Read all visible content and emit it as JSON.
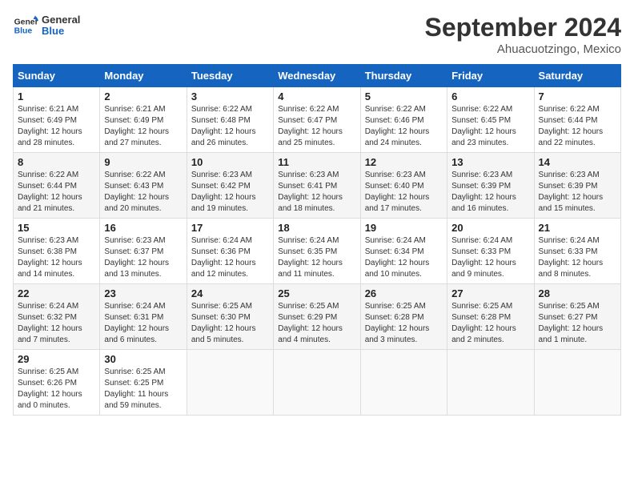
{
  "header": {
    "logo_line1": "General",
    "logo_line2": "Blue",
    "month": "September 2024",
    "location": "Ahuacuotzingo, Mexico"
  },
  "days_of_week": [
    "Sunday",
    "Monday",
    "Tuesday",
    "Wednesday",
    "Thursday",
    "Friday",
    "Saturday"
  ],
  "weeks": [
    [
      {
        "day": "1",
        "info": "Sunrise: 6:21 AM\nSunset: 6:49 PM\nDaylight: 12 hours\nand 28 minutes."
      },
      {
        "day": "2",
        "info": "Sunrise: 6:21 AM\nSunset: 6:49 PM\nDaylight: 12 hours\nand 27 minutes."
      },
      {
        "day": "3",
        "info": "Sunrise: 6:22 AM\nSunset: 6:48 PM\nDaylight: 12 hours\nand 26 minutes."
      },
      {
        "day": "4",
        "info": "Sunrise: 6:22 AM\nSunset: 6:47 PM\nDaylight: 12 hours\nand 25 minutes."
      },
      {
        "day": "5",
        "info": "Sunrise: 6:22 AM\nSunset: 6:46 PM\nDaylight: 12 hours\nand 24 minutes."
      },
      {
        "day": "6",
        "info": "Sunrise: 6:22 AM\nSunset: 6:45 PM\nDaylight: 12 hours\nand 23 minutes."
      },
      {
        "day": "7",
        "info": "Sunrise: 6:22 AM\nSunset: 6:44 PM\nDaylight: 12 hours\nand 22 minutes."
      }
    ],
    [
      {
        "day": "8",
        "info": "Sunrise: 6:22 AM\nSunset: 6:44 PM\nDaylight: 12 hours\nand 21 minutes."
      },
      {
        "day": "9",
        "info": "Sunrise: 6:22 AM\nSunset: 6:43 PM\nDaylight: 12 hours\nand 20 minutes."
      },
      {
        "day": "10",
        "info": "Sunrise: 6:23 AM\nSunset: 6:42 PM\nDaylight: 12 hours\nand 19 minutes."
      },
      {
        "day": "11",
        "info": "Sunrise: 6:23 AM\nSunset: 6:41 PM\nDaylight: 12 hours\nand 18 minutes."
      },
      {
        "day": "12",
        "info": "Sunrise: 6:23 AM\nSunset: 6:40 PM\nDaylight: 12 hours\nand 17 minutes."
      },
      {
        "day": "13",
        "info": "Sunrise: 6:23 AM\nSunset: 6:39 PM\nDaylight: 12 hours\nand 16 minutes."
      },
      {
        "day": "14",
        "info": "Sunrise: 6:23 AM\nSunset: 6:39 PM\nDaylight: 12 hours\nand 15 minutes."
      }
    ],
    [
      {
        "day": "15",
        "info": "Sunrise: 6:23 AM\nSunset: 6:38 PM\nDaylight: 12 hours\nand 14 minutes."
      },
      {
        "day": "16",
        "info": "Sunrise: 6:23 AM\nSunset: 6:37 PM\nDaylight: 12 hours\nand 13 minutes."
      },
      {
        "day": "17",
        "info": "Sunrise: 6:24 AM\nSunset: 6:36 PM\nDaylight: 12 hours\nand 12 minutes."
      },
      {
        "day": "18",
        "info": "Sunrise: 6:24 AM\nSunset: 6:35 PM\nDaylight: 12 hours\nand 11 minutes."
      },
      {
        "day": "19",
        "info": "Sunrise: 6:24 AM\nSunset: 6:34 PM\nDaylight: 12 hours\nand 10 minutes."
      },
      {
        "day": "20",
        "info": "Sunrise: 6:24 AM\nSunset: 6:33 PM\nDaylight: 12 hours\nand 9 minutes."
      },
      {
        "day": "21",
        "info": "Sunrise: 6:24 AM\nSunset: 6:33 PM\nDaylight: 12 hours\nand 8 minutes."
      }
    ],
    [
      {
        "day": "22",
        "info": "Sunrise: 6:24 AM\nSunset: 6:32 PM\nDaylight: 12 hours\nand 7 minutes."
      },
      {
        "day": "23",
        "info": "Sunrise: 6:24 AM\nSunset: 6:31 PM\nDaylight: 12 hours\nand 6 minutes."
      },
      {
        "day": "24",
        "info": "Sunrise: 6:25 AM\nSunset: 6:30 PM\nDaylight: 12 hours\nand 5 minutes."
      },
      {
        "day": "25",
        "info": "Sunrise: 6:25 AM\nSunset: 6:29 PM\nDaylight: 12 hours\nand 4 minutes."
      },
      {
        "day": "26",
        "info": "Sunrise: 6:25 AM\nSunset: 6:28 PM\nDaylight: 12 hours\nand 3 minutes."
      },
      {
        "day": "27",
        "info": "Sunrise: 6:25 AM\nSunset: 6:28 PM\nDaylight: 12 hours\nand 2 minutes."
      },
      {
        "day": "28",
        "info": "Sunrise: 6:25 AM\nSunset: 6:27 PM\nDaylight: 12 hours\nand 1 minute."
      }
    ],
    [
      {
        "day": "29",
        "info": "Sunrise: 6:25 AM\nSunset: 6:26 PM\nDaylight: 12 hours\nand 0 minutes."
      },
      {
        "day": "30",
        "info": "Sunrise: 6:25 AM\nSunset: 6:25 PM\nDaylight: 11 hours\nand 59 minutes."
      },
      {
        "day": "",
        "info": ""
      },
      {
        "day": "",
        "info": ""
      },
      {
        "day": "",
        "info": ""
      },
      {
        "day": "",
        "info": ""
      },
      {
        "day": "",
        "info": ""
      }
    ]
  ]
}
